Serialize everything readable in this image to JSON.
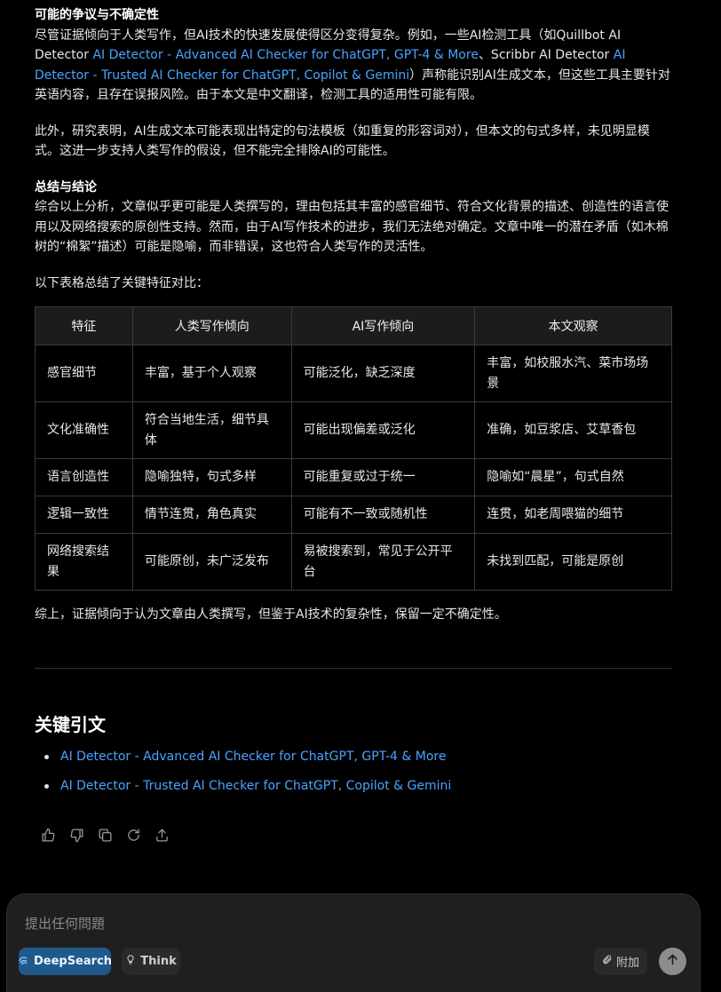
{
  "section_uncertainty": {
    "heading": "可能的争议与不确定性",
    "text_1": "尽管证据倾向于人类写作，但AI技术的快速发展使得区分变得复杂。例如，一些AI检测工具（如Quillbot AI Detector ",
    "link_1": "AI Detector - Advanced AI Checker for ChatGPT, GPT-4 & More",
    "text_2": "、Scribbr AI Detector ",
    "link_2": "AI Detector - Trusted AI Checker for ChatGPT, Copilot & Gemini",
    "text_3": "）声称能识别AI生成文本，但这些工具主要针对英语内容，且存在误报风险。由于本文是中文翻译，检测工具的适用性可能有限。"
  },
  "para_patterns": "此外，研究表明，AI生成文本可能表现出特定的句法模板（如重复的形容词对），但本文的句式多样，未见明显模式。这进一步支持人类写作的假设，但不能完全排除AI的可能性。",
  "section_summary": {
    "heading": "总结与结论",
    "text": "综合以上分析，文章似乎更可能是人类撰写的，理由包括其丰富的感官细节、符合文化背景的描述、创造性的语言使用以及网络搜索的原创性支持。然而，由于AI写作技术的进步，我们无法绝对确定。文章中唯一的潜在矛盾（如木棉树的“棉絮”描述）可能是隐喻，而非错误，这也符合人类写作的灵活性。"
  },
  "table_intro": "以下表格总结了关键特征对比：",
  "table": {
    "headers": [
      "特征",
      "人类写作倾向",
      "AI写作倾向",
      "本文观察"
    ],
    "rows": [
      [
        "感官细节",
        "丰富，基于个人观察",
        "可能泛化，缺乏深度",
        "丰富，如校服水汽、菜市场场景"
      ],
      [
        "文化准确性",
        "符合当地生活，细节具体",
        "可能出现偏差或泛化",
        "准确，如豆浆店、艾草香包"
      ],
      [
        "语言创造性",
        "隐喻独特，句式多样",
        "可能重复或过于统一",
        "隐喻如“晨星”，句式自然"
      ],
      [
        "逻辑一致性",
        "情节连贯，角色真实",
        "可能有不一致或随机性",
        "连贯，如老周喂猫的细节"
      ],
      [
        "网络搜索结果",
        "可能原创，未广泛发布",
        "易被搜索到，常见于公开平台",
        "未找到匹配，可能是原创"
      ]
    ]
  },
  "conclusion": "综上，证据倾向于认为文章由人类撰写，但鉴于AI技术的复杂性，保留一定不确定性。",
  "references": {
    "title": "关键引文",
    "items": [
      "AI Detector - Advanced AI Checker for ChatGPT, GPT-4 & More",
      "AI Detector - Trusted AI Checker for ChatGPT, Copilot & Gemini"
    ]
  },
  "actions": [
    "thumbs-up-icon",
    "thumbs-down-icon",
    "copy-icon",
    "regenerate-icon",
    "share-icon"
  ],
  "composer": {
    "placeholder": "提出任何問題",
    "deepsearch_label": "DeepSearch",
    "think_label": "Think",
    "attach_label": "附加"
  },
  "colors": {
    "link": "#4aa3ff",
    "deepsearch_bg": "#1f5a8a",
    "background": "#000000"
  }
}
